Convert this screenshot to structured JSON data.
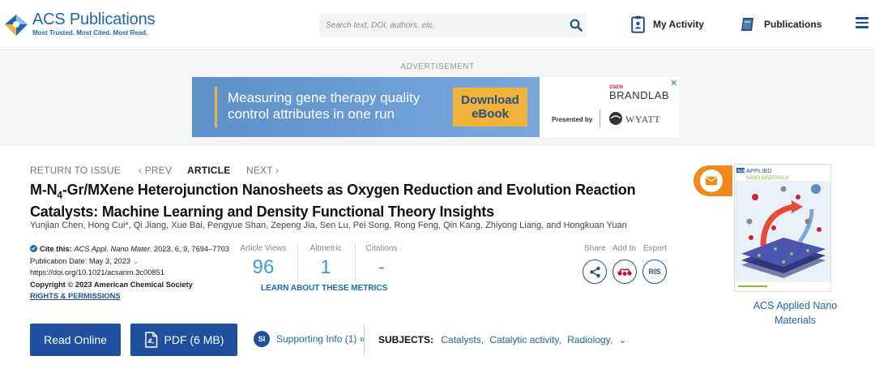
{
  "header": {
    "logo_title": "ACS Publications",
    "logo_tagline": "Most Trusted. Most Cited. Most Read.",
    "search_placeholder": "Search text, DOI, authors, etc.",
    "my_activity": "My Activity",
    "publications": "Publications",
    "icons": [
      "search-icon",
      "clipboard-icon",
      "book-icon",
      "menu-icon"
    ]
  },
  "ad": {
    "label": "ADVERTISEMENT",
    "headline": "Measuring gene therapy quality control attributes in one run",
    "cta": "Download eBook",
    "presented_by": "Presented by",
    "brand_top": "C&EN",
    "brand_name": "BRANDLAB",
    "sponsor": "WYATT",
    "close": "✕"
  },
  "article_nav": {
    "return": "RETURN TO ISSUE",
    "prev": "‹ PREV",
    "current": "ARTICLE",
    "next": "NEXT ›"
  },
  "article": {
    "title_pre": "M-N",
    "title_sub": "4",
    "title_post": "-Gr/MXene Heterojunction Nanosheets as Oxygen Reduction and Evolution Reaction Catalysts: Machine Learning and Density Functional Theory Insights",
    "authors": "Yunjian Chen, Hong Cui*, Qi Jiang, Xue Bai, Pengyue Shan, Zepeng Jia, Sen Lu, Pei Song, Rong Feng, Qin Kang, Zhiyong Liang, and Hongkuan Yuan"
  },
  "citation": {
    "cite_label": "Cite this:",
    "journal": "ACS Appl. Nano Mater.",
    "ref": "2023, 6, 9, 7694–7703",
    "pub_date": "Publication Date: May 3, 2023",
    "doi": "https://doi.org/10.1021/acsanm.3c00851",
    "copyright": "Copyright © 2023 American Chemical Society",
    "rights": "RIGHTS & PERMISSIONS"
  },
  "metrics": {
    "views_label": "Article Views",
    "views": "96",
    "altmetric_label": "Altmetric",
    "altmetric": "1",
    "citations_label": "Citations",
    "citations": "-",
    "learn": "LEARN ABOUT THESE METRICS"
  },
  "actions": {
    "share": "Share",
    "add_to": "Add to",
    "export": "Export",
    "ris": "RIS"
  },
  "buttons": {
    "read_online": "Read Online",
    "pdf": "PDF (6 MB)",
    "si_badge": "SI",
    "supporting_info": "Supporting Info (1) »"
  },
  "subjects": {
    "label": "SUBJECTS:",
    "items": [
      "Catalysts",
      "Catalytic activity",
      "Radiology"
    ]
  },
  "cover": {
    "brand_acs": "ACS",
    "brand_line1": "APPLIED",
    "brand_line2": "NANO MATERIALS",
    "journal_name": "ACS Applied Nano Materials"
  },
  "colors": {
    "acs_blue": "#1f66b0",
    "button_blue": "#1f4f9f",
    "metric_blue": "#3a9ed8",
    "alert_orange": "#f08a1c"
  }
}
